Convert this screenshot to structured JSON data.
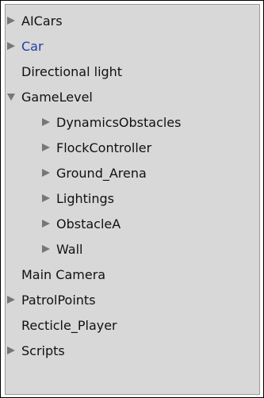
{
  "hierarchy": {
    "items": [
      {
        "label": "AICars",
        "expandable": true,
        "expanded": false,
        "level": 0
      },
      {
        "label": "Car",
        "expandable": true,
        "expanded": false,
        "level": 0,
        "selected": true
      },
      {
        "label": "Directional light",
        "expandable": false,
        "level": 0
      },
      {
        "label": "GameLevel",
        "expandable": true,
        "expanded": true,
        "level": 0
      },
      {
        "label": "DynamicsObstacles",
        "expandable": true,
        "expanded": false,
        "level": 1
      },
      {
        "label": "FlockController",
        "expandable": true,
        "expanded": false,
        "level": 1
      },
      {
        "label": "Ground_Arena",
        "expandable": true,
        "expanded": false,
        "level": 1
      },
      {
        "label": "Lightings",
        "expandable": true,
        "expanded": false,
        "level": 1
      },
      {
        "label": "ObstacleA",
        "expandable": true,
        "expanded": false,
        "level": 1
      },
      {
        "label": "Wall",
        "expandable": true,
        "expanded": false,
        "level": 1
      },
      {
        "label": "Main Camera",
        "expandable": false,
        "level": 0
      },
      {
        "label": "PatrolPoints",
        "expandable": true,
        "expanded": false,
        "level": 0
      },
      {
        "label": "Recticle_Player",
        "expandable": false,
        "level": 0
      },
      {
        "label": "Scripts",
        "expandable": true,
        "expanded": false,
        "level": 0
      }
    ]
  },
  "colors": {
    "panel_bg": "#d8d8d8",
    "selected_text": "#1f3fa5",
    "arrow": "#777777"
  }
}
